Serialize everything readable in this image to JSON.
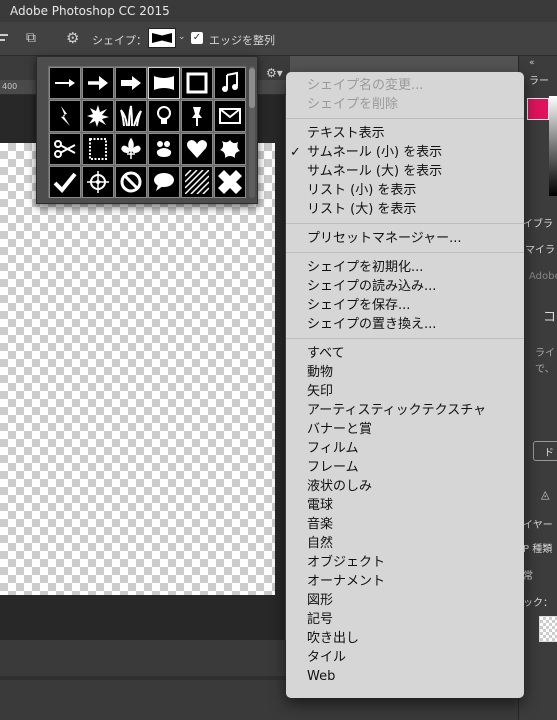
{
  "window": {
    "title": "Adobe Photoshop CC 2015"
  },
  "options_bar": {
    "shape_label": "シェイプ：",
    "align_edges_label": "エッジを整列",
    "align_edges_checked": true
  },
  "ruler": {
    "tick_label": "400"
  },
  "menu": {
    "group1": [
      "シェイプ名の変更...",
      "シェイプを削除"
    ],
    "group2": [
      "テキスト表示",
      "サムネール (小) を表示",
      "サムネール (大) を表示",
      "リスト (小) を表示",
      "リスト (大) を表示"
    ],
    "checked_item": "サムネール (小) を表示",
    "group3": [
      "プリセットマネージャー..."
    ],
    "group4": [
      "シェイプを初期化...",
      "シェイプの読み込み...",
      "シェイプを保存...",
      "シェイプの置き換え..."
    ],
    "group5": [
      "すべて",
      "動物",
      "矢印",
      "アーティスティックテクスチャ",
      "バナーと賞",
      "フィルム",
      "フレーム",
      "液状のしみ",
      "電球",
      "音楽",
      "自然",
      "オブジェクト",
      "オーナメント",
      "図形",
      "記号",
      "吹き出し",
      "タイル",
      "Web"
    ]
  },
  "right_panel": {
    "tab1": "ラー",
    "tab2": "イブラ",
    "lib_name": "マイラ",
    "lib_sub": "Adobe",
    "section_co": "コ",
    "desc1": "ライ",
    "desc2": "で、",
    "btn_d": "ド",
    "layers_tab": "イヤー",
    "kind_label": "P 種類",
    "blend_label": "常",
    "lock_label": "ック："
  },
  "shapes": [
    "arrow-thin",
    "arrow-bold",
    "arrow-block",
    "banner",
    "frame-square",
    "music-note",
    "lightning",
    "starburst",
    "grass",
    "lightbulb",
    "pushpin",
    "envelope",
    "scissors",
    "stamp-frame",
    "fleur-de-lis",
    "paw-blob",
    "heart",
    "splat",
    "checkmark",
    "target",
    "no-sign",
    "speech-bubble",
    "hatch-tile",
    "diamond-tile"
  ]
}
